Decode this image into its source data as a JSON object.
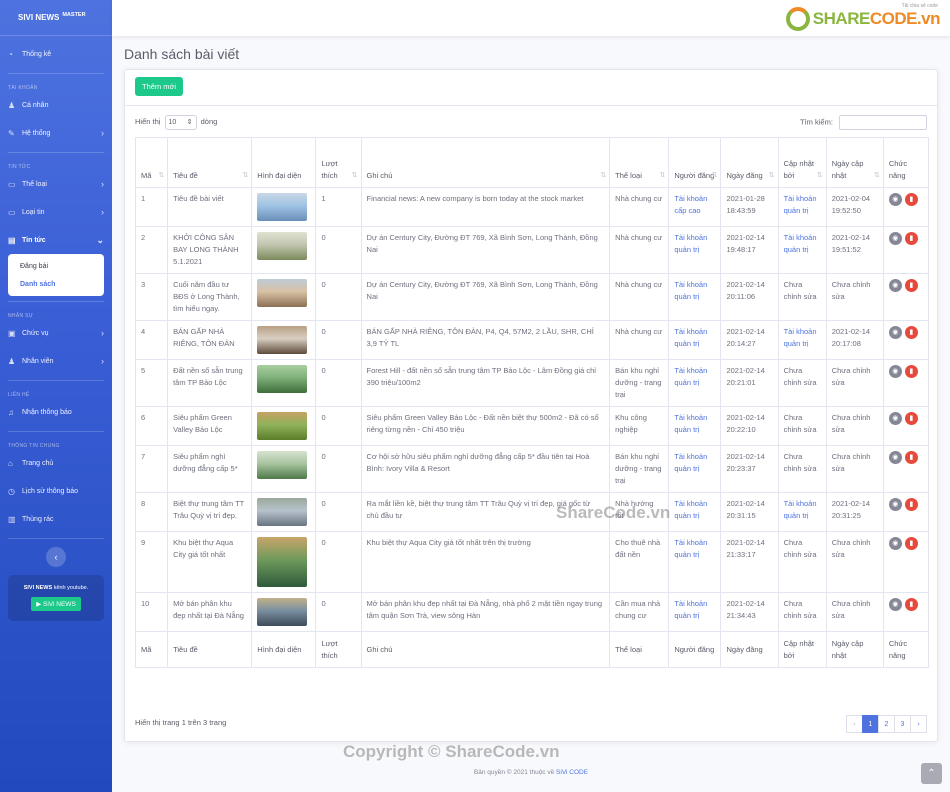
{
  "sidebar": {
    "brand": "SIVI NEWS",
    "brand_sup": "MASTER",
    "dashboard": "Thống kê",
    "sec_account": "TÀI KHOẢN",
    "personal": "Cá nhân",
    "system": "Hệ thống",
    "sec_news": "TIN TỨC",
    "category": "Thể loại",
    "news_type": "Loại tin",
    "news": "Tin tức",
    "sub_post": "Đăng bài",
    "sub_list": "Danh sách",
    "sec_staff": "NHÂN SỰ",
    "position": "Chức vụ",
    "staff": "Nhân viên",
    "sec_contact": "LIÊN HỆ",
    "notify_receive": "Nhận thông báo",
    "sec_general": "THÔNG TIN CHUNG",
    "home": "Trang chủ",
    "notify_history": "Lịch sử thông báo",
    "trash": "Thùng rác",
    "promo_brand": "SIVI NEWS",
    "promo_text": "kênh youtube.",
    "promo_button": "SiVi NEWS"
  },
  "topbar": {
    "logo_main": "SHARE",
    "logo_accent": "CODE.vn",
    "logo_sub": "Tải chia sẻ code"
  },
  "page": {
    "title": "Danh sách bài viết",
    "add_button": "Thêm mới",
    "show_label": "Hiển thị",
    "show_value": "10",
    "rows_label": "dòng",
    "search_label": "Tìm kiếm:",
    "info": "Hiển thị trang 1 trên 3 trang"
  },
  "table": {
    "headers": [
      "Mã",
      "Tiêu đề",
      "Hình đại diện",
      "Lượt thích",
      "Ghi chú",
      "Thể loại",
      "Người đăng",
      "Ngày đăng",
      "Cập nhật bởi",
      "Ngày cập nhật",
      "Chức năng"
    ],
    "rows": [
      {
        "id": "1",
        "title": "Tiêu đề bài viết",
        "likes": "1",
        "note": "Financial news: A new company is born today at the stock market",
        "category": "Nhà chung cư",
        "author": "Tài khoản cấp cao",
        "date": "2021-01-28 18:43:59",
        "updated_by": "Tài khoản quản trị",
        "updated_at": "2021-02-04 19:52:50"
      },
      {
        "id": "2",
        "title": "KHỞI CÔNG SÂN BAY LONG THÀNH 5.1.2021",
        "likes": "0",
        "note": "Dự án Century City, Đường ĐT 769, Xã Bình Sơn, Long Thành, Đồng Nai",
        "category": "Nhà chung cư",
        "author": "Tài khoản quản trị",
        "date": "2021-02-14 19:48:17",
        "updated_by": "Tài khoản quản trị",
        "updated_at": "2021-02-14 19:51:52"
      },
      {
        "id": "3",
        "title": "Cuối năm đầu tư BĐS ở Long Thành, tìm hiểu ngay.",
        "likes": "0",
        "note": "Dự án Century City, Đường ĐT 769, Xã Bình Sơn, Long Thành, Đồng Nai",
        "category": "Nhà chung cư",
        "author": "Tài khoản quản trị",
        "date": "2021-02-14 20:11:06",
        "updated_by": "Chưa chỉnh sửa",
        "updated_at": "Chưa chỉnh sửa"
      },
      {
        "id": "4",
        "title": "BÁN GẤP NHÀ RIÊNG, TÔN ĐẢN",
        "likes": "0",
        "note": "BÁN GẤP NHÀ RIÊNG, TÔN ĐẢN, P4, Q4, 57M2, 2 LẦU, SHR, CHỈ 3,9 TỶ TL",
        "category": "Nhà chung cư",
        "author": "Tài khoản quản trị",
        "date": "2021-02-14 20:14:27",
        "updated_by": "Tài khoản quản trị",
        "updated_at": "2021-02-14 20:17:08"
      },
      {
        "id": "5",
        "title": "Đất nền sổ sẵn trung tâm TP Bảo Lộc",
        "likes": "0",
        "note": "Forest Hill - đất nền sổ sẵn trung tâm TP Bảo Lộc - Lâm Đồng giá chỉ 390 triệu/100m2",
        "category": "Bán khu nghỉ dưỡng - trang trại",
        "author": "Tài khoản quản trị",
        "date": "2021-02-14 20:21:01",
        "updated_by": "Chưa chỉnh sửa",
        "updated_at": "Chưa chỉnh sửa"
      },
      {
        "id": "6",
        "title": "Siêu phẩm Green Valley Bảo Lộc",
        "likes": "0",
        "note": "Siêu phẩm Green Valley Bảo Lộc - Đất nền biệt thự 500m2 - Đã có sổ riêng từng nền - Chỉ 450 triệu",
        "category": "Khu công nghiệp",
        "author": "Tài khoản quản trị",
        "date": "2021-02-14 20:22:10",
        "updated_by": "Chưa chỉnh sửa",
        "updated_at": "Chưa chỉnh sửa"
      },
      {
        "id": "7",
        "title": "Siêu phẩm nghỉ dưỡng đẳng cấp 5*",
        "likes": "0",
        "note": "Cơ hội sở hữu siêu phẩm nghỉ dưỡng đẳng cấp 5* đầu tiên tại Hoà Bình: Ivory Villa & Resort",
        "category": "Bán khu nghỉ dưỡng - trang trại",
        "author": "Tài khoản quản trị",
        "date": "2021-02-14 20:23:37",
        "updated_by": "Chưa chỉnh sửa",
        "updated_at": "Chưa chỉnh sửa"
      },
      {
        "id": "8",
        "title": "Biệt thự trung tâm TT Trâu Quỳ vị trí đẹp.",
        "likes": "0",
        "note": "Ra mắt liền kề, biệt thự trung tâm TT Trâu Quỳ vị trí đẹp, giá gốc từ chủ đầu tư",
        "category": "Nhà hướng tốt",
        "author": "Tài khoản quản trị",
        "date": "2021-02-14 20:31:15",
        "updated_by": "Tài khoản quản trị",
        "updated_at": "2021-02-14 20:31:25"
      },
      {
        "id": "9",
        "title": "Khu biệt thự Aqua City giá tốt nhất",
        "likes": "0",
        "note": "Khu biệt thự Aqua City giá tốt nhất trên thị trường",
        "category": "Cho thuê nhà đất nền",
        "author": "Tài khoản quản trị",
        "date": "2021-02-14 21:33:17",
        "updated_by": "Chưa chỉnh sửa",
        "updated_at": "Chưa chỉnh sửa"
      },
      {
        "id": "10",
        "title": "Mở bán phân khu đẹp nhất tại Đà Nẵng",
        "likes": "0",
        "note": "Mở bán phân khu đẹp nhất tại Đà Nẵng, nhà phố 2 mặt tiền ngay trung tâm quận Sơn Trà, view sông Hàn",
        "category": "Cần mua nhà chung cư",
        "author": "Tài khoản quản trị",
        "date": "2021-02-14 21:34:43",
        "updated_by": "Chưa chỉnh sửa",
        "updated_at": "Chưa chỉnh sửa"
      }
    ]
  },
  "pagination": {
    "prev": "‹",
    "pages": [
      "1",
      "2",
      "3"
    ],
    "next": "›",
    "current": "1"
  },
  "footer": {
    "copyright": "Bản quyền © 2021 thuộc về",
    "brand": "SiVi CODE"
  },
  "watermarks": {
    "center": "ShareCode.vn",
    "bottom": "Copyright © ShareCode.vn"
  },
  "colors": {
    "primary": "#4e73df",
    "success": "#1cc88a",
    "danger": "#e74a3b",
    "secondary": "#858796"
  }
}
